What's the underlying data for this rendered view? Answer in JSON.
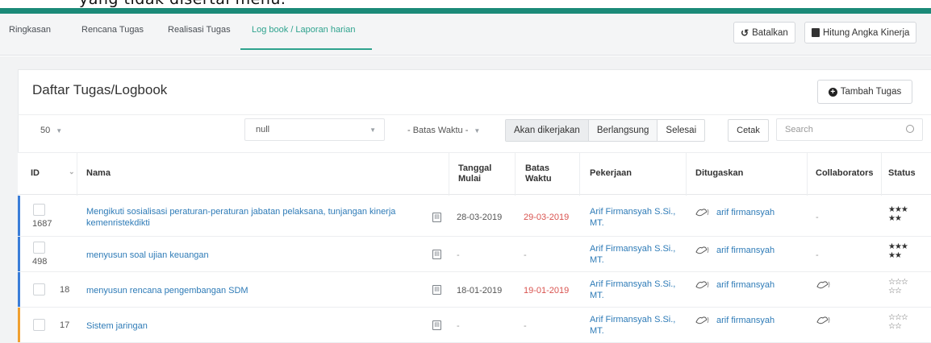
{
  "top_fragment": "yang tidak disertai menu.",
  "tabs": [
    {
      "label": "Ringkasan"
    },
    {
      "label": "Rencana Tugas"
    },
    {
      "label": "Realisasi Tugas"
    },
    {
      "label": "Log book / Laporan harian",
      "active": true
    }
  ],
  "toolbar": {
    "undo_label": "Batalkan",
    "calc_label": "Hitung Angka Kinerja"
  },
  "panel": {
    "title": "Daftar Tugas/Logbook",
    "add_label": "Tambah Tugas"
  },
  "filters": {
    "page_size": "50",
    "null_select": "null",
    "deadline_select": "- Batas Waktu -",
    "segments": [
      "Akan dikerjakan",
      "Berlangsung",
      "Selesai"
    ],
    "print_label": "Cetak",
    "search_placeholder": "Search"
  },
  "columns": {
    "id": "ID",
    "nama": "Nama",
    "tanggal_mulai_1": "Tanggal",
    "tanggal_mulai_2": "Mulai",
    "batas_waktu_1": "Batas",
    "batas_waktu_2": "Waktu",
    "pekerjaan": "Pekerjaan",
    "ditugaskan": "Ditugaskan",
    "collaborators": "Collaborators",
    "status": "Status"
  },
  "rows": [
    {
      "id": "1687",
      "nama_1": "Mengikuti sosialisasi peraturan-peraturan jabatan pelaksana, tunjangan kinerja",
      "nama_2": "kemenristekdikti",
      "tanggal_mulai": "28-03-2019",
      "batas_waktu": "29-03-2019",
      "pekerjaan_1": "Arif Firmansyah S.Si.,",
      "pekerjaan_2": "MT.",
      "ditugaskan": "arif firmansyah",
      "collaborators": "-",
      "stars_1": "★★★",
      "stars_2": "★★",
      "bar_color": "#3b7dd8"
    },
    {
      "id": "498",
      "nama_1": "menyusun soal ujian keuangan",
      "nama_2": "",
      "tanggal_mulai": "-",
      "batas_waktu": "-",
      "pekerjaan_1": "Arif Firmansyah S.Si.,",
      "pekerjaan_2": "MT.",
      "ditugaskan": "arif firmansyah",
      "collaborators": "-",
      "stars_1": "★★★",
      "stars_2": "★★",
      "bar_color": "#3b7dd8"
    },
    {
      "id": "18",
      "nama_1": "menyusun rencana pengembangan SDM",
      "nama_2": "",
      "tanggal_mulai": "18-01-2019",
      "batas_waktu": "19-01-2019",
      "pekerjaan_1": "Arif Firmansyah S.Si.,",
      "pekerjaan_2": "MT.",
      "ditugaskan": "arif firmansyah",
      "collaborators": "",
      "stars_1": "☆☆☆",
      "stars_2": "☆☆",
      "bar_color": "#3b7dd8"
    },
    {
      "id": "17",
      "nama_1": "Sistem jaringan",
      "nama_2": "",
      "tanggal_mulai": "-",
      "batas_waktu": "-",
      "pekerjaan_1": "Arif Firmansyah S.Si.,",
      "pekerjaan_2": "MT.",
      "ditugaskan": "arif firmansyah",
      "collaborators": "",
      "stars_1": "☆☆☆",
      "stars_2": "☆☆",
      "bar_color": "#f0a030"
    }
  ]
}
